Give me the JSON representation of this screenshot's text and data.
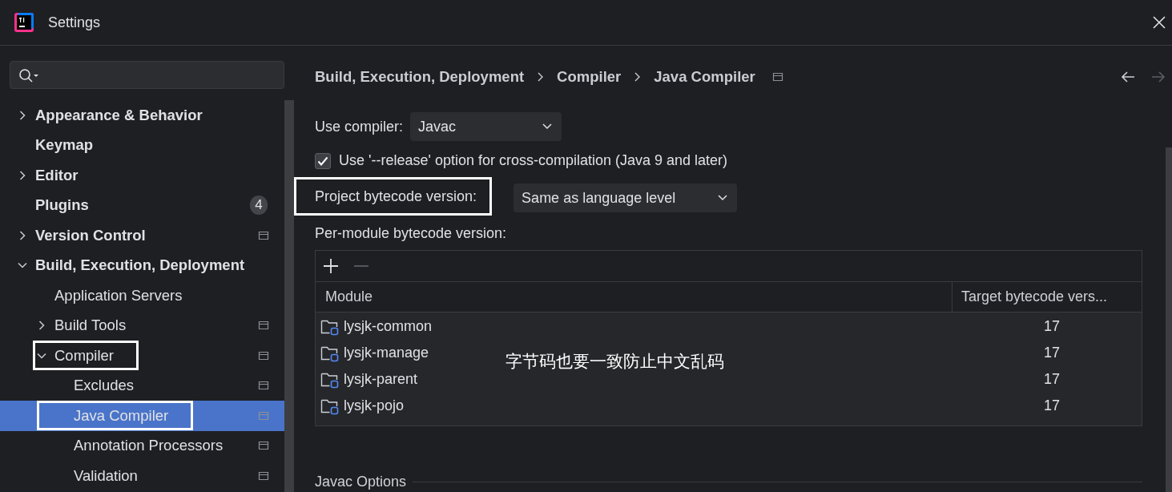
{
  "window": {
    "title": "Settings"
  },
  "sidebar": {
    "items": [
      {
        "label": "Appearance & Behavior",
        "bold": true,
        "expandable": true,
        "expanded": false,
        "selected": false,
        "project_scoped": false,
        "annotated": false
      },
      {
        "label": "Keymap",
        "bold": true,
        "expandable": false,
        "selected": false,
        "project_scoped": false,
        "annotated": false
      },
      {
        "label": "Editor",
        "bold": true,
        "expandable": true,
        "expanded": false,
        "selected": false,
        "project_scoped": false,
        "annotated": false
      },
      {
        "label": "Plugins",
        "bold": true,
        "expandable": false,
        "selected": false,
        "project_scoped": false,
        "annotated": false,
        "badge": "4"
      },
      {
        "label": "Version Control",
        "bold": true,
        "expandable": true,
        "expanded": false,
        "selected": false,
        "project_scoped": true,
        "annotated": false
      },
      {
        "label": "Build, Execution, Deployment",
        "bold": true,
        "expandable": true,
        "expanded": true,
        "selected": false,
        "project_scoped": false,
        "annotated": false,
        "children": [
          {
            "label": "Application Servers",
            "bold": false,
            "expandable": false,
            "selected": false,
            "project_scoped": false,
            "annotated": false
          },
          {
            "label": "Build Tools",
            "bold": false,
            "expandable": true,
            "expanded": false,
            "selected": false,
            "project_scoped": true,
            "annotated": false
          },
          {
            "label": "Compiler",
            "bold": false,
            "expandable": true,
            "expanded": true,
            "selected": false,
            "project_scoped": true,
            "annotated": true,
            "children": [
              {
                "label": "Excludes",
                "bold": false,
                "expandable": false,
                "selected": false,
                "project_scoped": true,
                "annotated": false
              },
              {
                "label": "Java Compiler",
                "bold": false,
                "expandable": false,
                "selected": true,
                "project_scoped": true,
                "annotated": true
              },
              {
                "label": "Annotation Processors",
                "bold": false,
                "expandable": false,
                "selected": false,
                "project_scoped": true,
                "annotated": false
              },
              {
                "label": "Validation",
                "bold": false,
                "expandable": false,
                "selected": false,
                "project_scoped": true,
                "annotated": false
              }
            ]
          }
        ]
      }
    ]
  },
  "breadcrumb": {
    "items": [
      "Build, Execution, Deployment",
      "Compiler",
      "Java Compiler"
    ],
    "project_scoped": true,
    "back_disabled": false,
    "forward_disabled": true
  },
  "use_compiler": {
    "label": "Use compiler:",
    "value": "Javac"
  },
  "release_option": {
    "label": "Use '--release' option for cross-compilation (Java 9 and later)",
    "checked": true
  },
  "project_bytecode": {
    "label": "Project bytecode version:",
    "value": "Same as language level",
    "annotated": true
  },
  "per_module": {
    "label": "Per-module bytecode version:",
    "add_disabled": false,
    "remove_disabled": true,
    "table": {
      "columns": [
        "Module",
        "Target bytecode vers..."
      ],
      "rows": [
        {
          "module": "lysjk-common",
          "target": "17"
        },
        {
          "module": "lysjk-manage",
          "target": "17"
        },
        {
          "module": "lysjk-parent",
          "target": "17"
        },
        {
          "module": "lysjk-pojo",
          "target": "17"
        }
      ]
    }
  },
  "annotation_note": "字节码也要一致防止中文乱码",
  "javac_options": {
    "title": "Javac Options"
  }
}
